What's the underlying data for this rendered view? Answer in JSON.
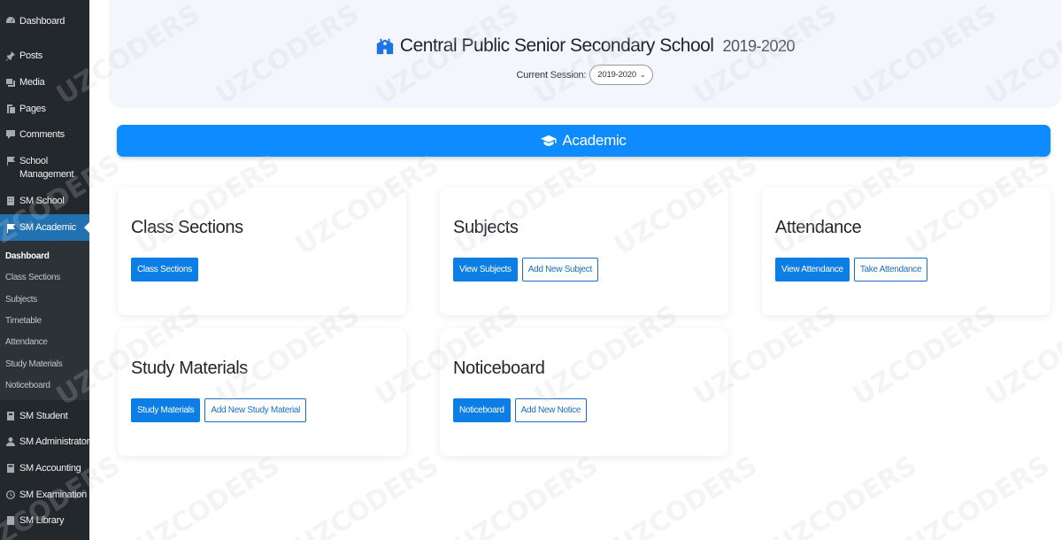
{
  "sidebar": {
    "items": [
      {
        "label": "Dashboard",
        "icon": "dashboard-icon"
      },
      {
        "label": "Posts",
        "icon": "pin-icon"
      },
      {
        "label": "Media",
        "icon": "media-icon"
      },
      {
        "label": "Pages",
        "icon": "pages-icon"
      },
      {
        "label": "Comments",
        "icon": "comment-icon"
      },
      {
        "label": "School Management",
        "icon": "flag-icon"
      },
      {
        "label": "SM School",
        "icon": "building-icon"
      },
      {
        "label": "SM Academic",
        "icon": "flag-icon"
      },
      {
        "label": "SM Student",
        "icon": "graduation-icon"
      },
      {
        "label": "SM Administrator",
        "icon": "user-icon"
      },
      {
        "label": "SM Accounting",
        "icon": "calculator-icon"
      },
      {
        "label": "SM Examination",
        "icon": "clock-icon"
      },
      {
        "label": "SM Library",
        "icon": "book-icon"
      }
    ],
    "submenu": [
      "Dashboard",
      "Class Sections",
      "Subjects",
      "Timetable",
      "Attendance",
      "Study Materials",
      "Noticeboard"
    ]
  },
  "header": {
    "school_name": "Central Public Senior Secondary School",
    "year": "2019-2020",
    "session_label": "Current Session:",
    "session_value": "2019-2020"
  },
  "academic": {
    "label": "Academic"
  },
  "cards": [
    {
      "title": "Class Sections",
      "buttons": [
        "Class Sections"
      ]
    },
    {
      "title": "Subjects",
      "buttons": [
        "View Subjects",
        "Add New Subject"
      ]
    },
    {
      "title": "Attendance",
      "buttons": [
        "View Attendance",
        "Take Attendance"
      ]
    },
    {
      "title": "Study Materials",
      "buttons": [
        "Study Materials",
        "Add New Study Material"
      ]
    },
    {
      "title": "Noticeboard",
      "buttons": [
        "Noticeboard",
        "Add New Notice"
      ]
    }
  ],
  "watermark": "UZCODERS",
  "colors": {
    "sidebar": "#23282d",
    "active": "#2271b1",
    "accent": "#0d8bff"
  }
}
